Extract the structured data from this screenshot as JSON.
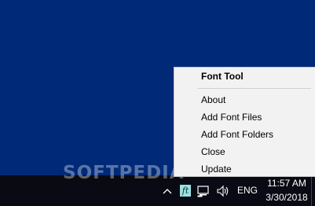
{
  "watermark": "SOFTPEDIA",
  "context_menu": {
    "title": "Font Tool",
    "items": [
      {
        "label": "About"
      },
      {
        "label": "Add Font Files"
      },
      {
        "label": "Add Font Folders"
      },
      {
        "label": "Close"
      },
      {
        "label": "Update"
      }
    ]
  },
  "taskbar": {
    "tray_icons": [
      "chevron-up-icon",
      "font-tool-icon",
      "network-icon",
      "volume-icon"
    ],
    "font_tool_icon_glyph": "ft",
    "language": "ENG",
    "time": "11:57 AM",
    "date": "3/30/2018"
  },
  "colors": {
    "desktop": "#002a78",
    "menu_background": "#f2f2f2",
    "taskbar": "#0a0a14",
    "font_tool_icon": "#9fe0e0"
  }
}
